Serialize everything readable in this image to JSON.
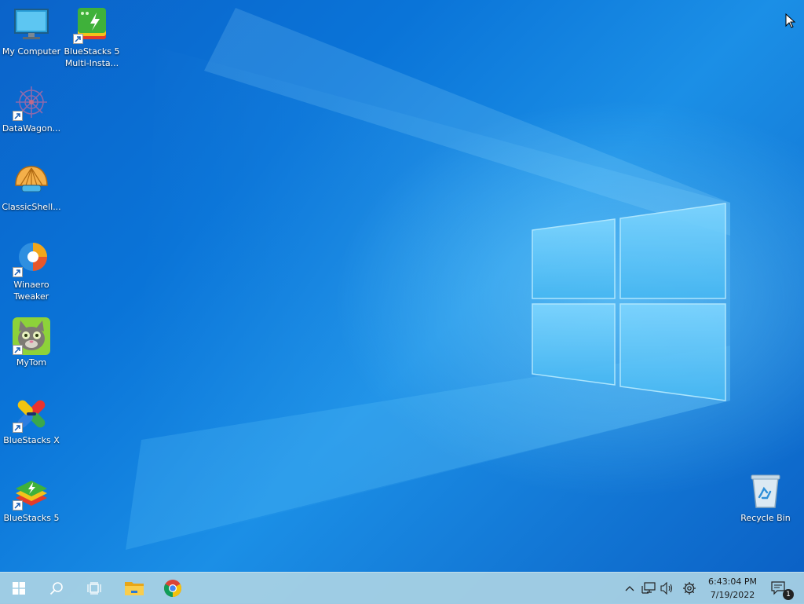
{
  "desktop": {
    "icons": [
      {
        "label": "My Computer",
        "icon": "monitor-icon"
      },
      {
        "label": "BlueStacks 5\nMulti-Insta...",
        "icon": "bluestacks-multi-instance-icon"
      },
      {
        "label": "DataWagon...",
        "icon": "datawagon-icon"
      },
      {
        "label": "ClassicShell...",
        "icon": "classic-shell-icon"
      },
      {
        "label": "Winaero\nTweaker",
        "icon": "winaero-tweaker-icon"
      },
      {
        "label": "MyTom",
        "icon": "mytom-icon"
      },
      {
        "label": "BlueStacks X",
        "icon": "bluestacks-x-icon"
      },
      {
        "label": "BlueStacks 5",
        "icon": "bluestacks-5-icon"
      },
      {
        "label": "Recycle Bin",
        "icon": "recycle-bin-icon"
      }
    ]
  },
  "taskbar": {
    "start": "windows-start-icon",
    "search": "search-icon",
    "task_view": "task-view-icon",
    "pinned": [
      "file-explorer-icon",
      "chrome-icon"
    ],
    "tray": [
      "chevron-up-icon",
      "network-icon",
      "volume-icon",
      "settings-gear-icon"
    ],
    "time": "6:43:04 PM",
    "date": "7/19/2022",
    "notifications_count": "1"
  },
  "colors": {
    "wallpaper": "#0a74d8",
    "taskbar": "#aad2e4"
  }
}
